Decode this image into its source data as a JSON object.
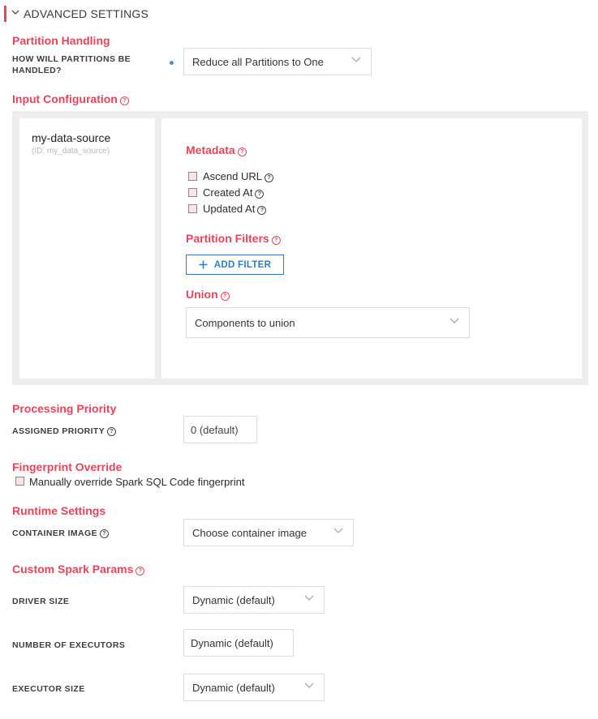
{
  "header": {
    "title": "ADVANCED SETTINGS"
  },
  "partition_handling": {
    "title": "Partition Handling",
    "label": "HOW WILL PARTITIONS BE HANDLED?",
    "value": "Reduce all Partitions to One"
  },
  "input_configuration": {
    "title": "Input Configuration",
    "source": {
      "name": "my-data-source",
      "id": "(ID: my_data_source)"
    },
    "metadata": {
      "title": "Metadata",
      "items": [
        {
          "label": "Ascend URL",
          "checked": false
        },
        {
          "label": "Created At",
          "checked": false
        },
        {
          "label": "Updated At",
          "checked": false
        }
      ]
    },
    "partition_filters": {
      "title": "Partition Filters",
      "button": "ADD FILTER"
    },
    "union": {
      "title": "Union",
      "placeholder": "Components to union"
    }
  },
  "processing_priority": {
    "title": "Processing Priority",
    "label": "ASSIGNED PRIORITY",
    "placeholder": "0 (default)"
  },
  "fingerprint_override": {
    "title": "Fingerprint Override",
    "checkbox_label": "Manually override Spark SQL Code fingerprint",
    "checked": false
  },
  "runtime_settings": {
    "title": "Runtime Settings",
    "label": "CONTAINER IMAGE",
    "placeholder": "Choose container image"
  },
  "custom_spark_params": {
    "title": "Custom Spark Params",
    "driver_size": {
      "label": "DRIVER SIZE",
      "value": "Dynamic (default)"
    },
    "num_executors": {
      "label": "NUMBER OF EXECUTORS",
      "placeholder": "Dynamic (default)"
    },
    "executor_size": {
      "label": "EXECUTOR SIZE",
      "value": "Dynamic (default)"
    }
  },
  "colors": {
    "accent": "#e0475a",
    "link": "#2d7bc6",
    "panel_bg": "#ededed"
  },
  "icons": [
    "chevron-down-icon",
    "help-icon",
    "plus-icon"
  ]
}
